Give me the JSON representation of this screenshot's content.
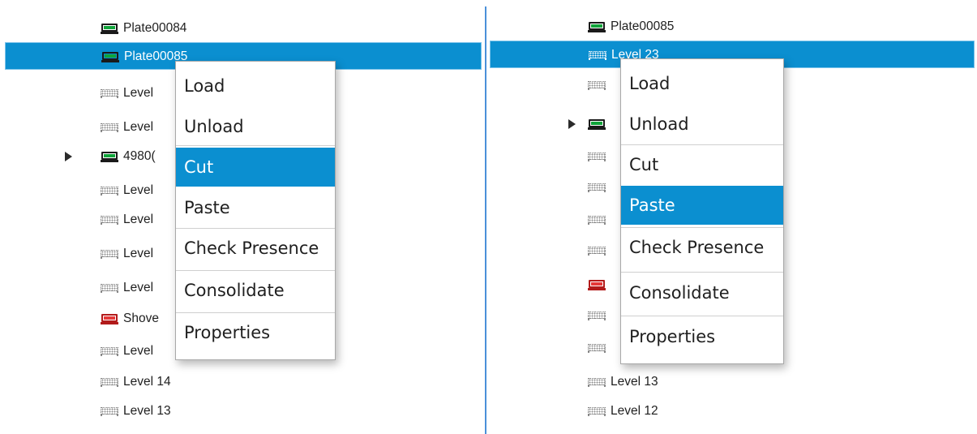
{
  "left_tree": {
    "rows": [
      {
        "label": "Plate00084",
        "icon": "plate-green-icon"
      },
      {
        "label": "Plate00085",
        "icon": "plate-green-icon",
        "selected": true
      },
      {
        "label": "Level",
        "icon": "level-icon"
      },
      {
        "label": "Level",
        "icon": "level-icon"
      },
      {
        "label": "4980(",
        "icon": "plate-green-icon",
        "expander": true
      },
      {
        "label": "Level",
        "icon": "level-icon"
      },
      {
        "label": "Level",
        "icon": "level-icon"
      },
      {
        "label": "Level",
        "icon": "level-icon"
      },
      {
        "label": "Level",
        "icon": "level-icon"
      },
      {
        "label": "Shove",
        "icon": "plate-red-icon"
      },
      {
        "label": "Level",
        "icon": "level-icon"
      },
      {
        "label": "Level 14",
        "icon": "level-icon"
      },
      {
        "label": "Level 13",
        "icon": "level-icon"
      }
    ]
  },
  "left_menu": {
    "items": [
      "Load",
      "Unload",
      "Cut",
      "Paste",
      "Check Presence",
      "Consolidate",
      "Properties"
    ],
    "highlighted": "Cut"
  },
  "right_tree": {
    "rows": [
      {
        "label": "Plate00085",
        "icon": "plate-green-icon"
      },
      {
        "label": "Level 23",
        "icon": "level-icon",
        "selected": true
      },
      {
        "label": "",
        "icon": "level-icon"
      },
      {
        "label": "",
        "icon": "plate-green-icon",
        "expander": true
      },
      {
        "label": "",
        "icon": "level-icon"
      },
      {
        "label": "",
        "icon": "level-icon"
      },
      {
        "label": "",
        "icon": "level-icon"
      },
      {
        "label": "",
        "icon": "level-icon"
      },
      {
        "label": "",
        "icon": "plate-red-icon"
      },
      {
        "label": "",
        "icon": "level-icon"
      },
      {
        "label": "",
        "icon": "level-icon"
      },
      {
        "label": "Level 13",
        "icon": "level-icon"
      },
      {
        "label": "Level 12",
        "icon": "level-icon"
      }
    ]
  },
  "right_menu": {
    "items": [
      "Load",
      "Unload",
      "Cut",
      "Paste",
      "Check Presence",
      "Consolidate",
      "Properties"
    ],
    "highlighted": "Paste"
  },
  "colors": {
    "selection": "#0b8fd0",
    "plate_green": "#10a43a",
    "plate_red": "#e53939"
  }
}
